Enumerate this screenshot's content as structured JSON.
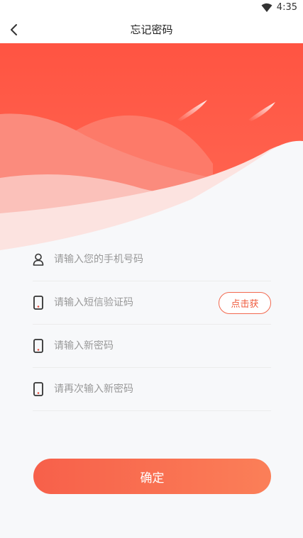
{
  "status_bar": {
    "time": "4:35",
    "wifi_icon": "wifi-icon"
  },
  "header": {
    "title": "忘记密码",
    "back_icon": "chevron-left-icon"
  },
  "form": {
    "phone": {
      "placeholder": "请输入您的手机号码",
      "icon": "user-icon"
    },
    "sms_code": {
      "placeholder": "请输入短信验证码",
      "icon": "phone-icon",
      "get_code_label": "点击获"
    },
    "new_password": {
      "placeholder": "请输入新密码",
      "icon": "phone-icon"
    },
    "confirm_password": {
      "placeholder": "请再次输入新密码",
      "icon": "phone-icon"
    }
  },
  "confirm_button": {
    "label": "确定"
  },
  "colors": {
    "accent": "#f55b45",
    "hero_top": "#ff5a47",
    "hero_light": "#fbd6d2",
    "background": "#f7f8fa"
  }
}
